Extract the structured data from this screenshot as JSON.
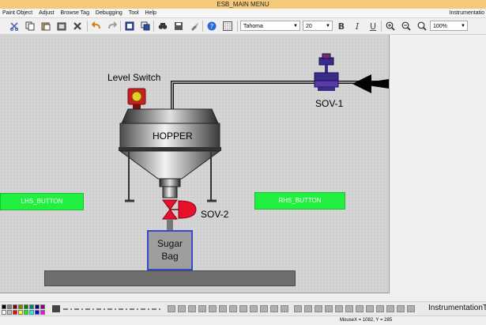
{
  "window": {
    "title": "ESB_MAIN MENU",
    "right_title": "Instrumentatio"
  },
  "menu": [
    "Paint Object",
    "Adjust",
    "Browse Tag",
    "Debugging",
    "Tool",
    "Help"
  ],
  "toolbar": {
    "font": "Tahoma",
    "font_size": "20",
    "zoom": "100%",
    "icons": [
      "cut-icon",
      "copy-icon",
      "paste-icon",
      "paste-special-icon",
      "delete-icon",
      "undo-icon",
      "redo-icon",
      "front-icon",
      "back-icon",
      "find-icon",
      "save-icon",
      "paint-icon",
      "help-icon",
      "grid-icon",
      "bold-icon",
      "italic-icon",
      "underline-icon",
      "zoom-in-icon",
      "zoom-out-icon",
      "zoom-fit-icon"
    ]
  },
  "canvas": {
    "level_switch_label": "Level Switch",
    "sov1_label": "SOV-1",
    "hopper_label": "HOPPER",
    "sov2_label": "SOV-2",
    "bag_line1": "Sugar",
    "bag_line2": "Bag",
    "lhs_button": "LHS_BUTTON",
    "rhs_button": "RHS_BUTTON"
  },
  "colors": {
    "canvas_bg": "#d4d4d4",
    "button_green": "#22f040",
    "bag_border": "#3848c8",
    "valve_red": "#e8102a",
    "sov1_purple": "#3a2a8a",
    "level_switch_red": "#c82020"
  },
  "bottom": {
    "brand_text": "InstrumentationT"
  },
  "status": {
    "mouse_position": "MouseX = 1082, Y = 285"
  }
}
